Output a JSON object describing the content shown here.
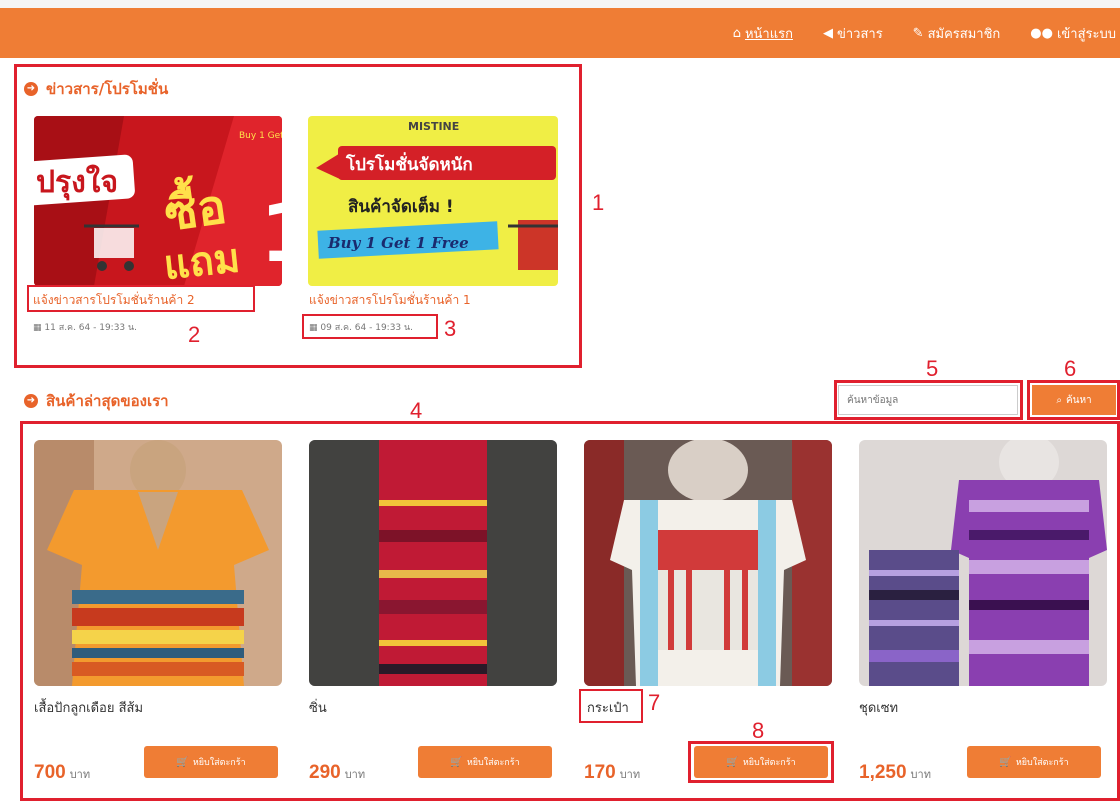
{
  "nav": {
    "items": [
      {
        "label": "หน้าแรก",
        "icon": "home-icon",
        "glyph": "⌂",
        "active": true
      },
      {
        "label": "ข่าวสาร",
        "icon": "megaphone-icon",
        "glyph": "📢",
        "active": false
      },
      {
        "label": "สมัครสมาชิก",
        "icon": "pencil-icon",
        "glyph": "✎",
        "active": false
      },
      {
        "label": "เข้าสู่ระบบ",
        "icon": "users-icon",
        "glyph": "👥",
        "active": false
      }
    ]
  },
  "news": {
    "title": "ข่าวสาร/โปรโมชั่น",
    "items": [
      {
        "title": "แจ้งข่าวสารโปรโมชั่นร้านค้า 2",
        "date": "11 ส.ค. 64 - 19:33 น.",
        "banner": {
          "t1": "ปรุงใจ",
          "t2": "ซื้อ",
          "t3": "แถม",
          "t4": "Buy 1 Get 1"
        }
      },
      {
        "title": "แจ้งข่าวสารโปรโมชั่นร้านค้า 1",
        "date": "09 ส.ค. 64 - 19:33 น.",
        "banner": {
          "brand": "MISTINE",
          "t1": "โปรโมชั่นจัดหนัก",
          "t2": "สินค้าจัดเต็ม !",
          "t3": "Buy 1 Get 1 Free"
        }
      }
    ]
  },
  "products": {
    "title": "สินค้าล่าสุดของเรา",
    "search_placeholder": "ค้นหาข้อมูล",
    "search_label": "ค้นหา",
    "cart_label": "หยิบใส่ตะกร้า",
    "currency": "บาท",
    "items": [
      {
        "name": "เสื้อปักลูกเดือย สีส้ม",
        "price": "700"
      },
      {
        "name": "ซิ่น",
        "price": "290"
      },
      {
        "name": "กระเป๋า",
        "price": "170"
      },
      {
        "name": "ชุดเซท",
        "price": "1,250"
      }
    ]
  },
  "annotations": [
    "1",
    "2",
    "3",
    "4",
    "5",
    "6",
    "7",
    "8"
  ],
  "colors": {
    "accent": "#ef7d35",
    "title": "#e8632a",
    "annotation": "#e0202e"
  }
}
